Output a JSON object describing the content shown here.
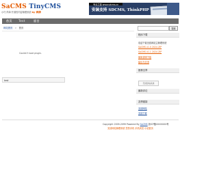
{
  "logo": {
    "part1": "SaCMS",
    "part2": "TinyCMS",
    "tagline": "小巧·简单·开源的内容管理系统",
    "accent": "by 奔牌"
  },
  "banner": {
    "url": "专业之选 www.sdcms.cn",
    "text": "安装支持 SDCMS, ThinkPHP",
    "bg_color": "#2a3f66"
  },
  "nav": {
    "items": [
      "首页",
      "Test",
      "留言"
    ]
  },
  "breadcrumb": {
    "home": "网站首页",
    "separator": ">",
    "current": "首页"
  },
  "search": {
    "placeholder": "",
    "button": "搜索"
  },
  "main": {
    "message": "Couldn't load plugin.",
    "textbox": "test"
  },
  "sidebar": {
    "download_title": "程序下载",
    "download_desc": "欢迎下载无线网站主管理系统",
    "download_links": [
      "SaCMS v1.0 2024 ZIP",
      "SaCMS v1.1 2024 ZIP",
      "使用说明下载",
      "建议与交流"
    ],
    "recommend_title": "推荐文章",
    "recommend_image_alt": "无线建站系统",
    "latest_comments_title": "最新评论",
    "friendlinks_title": "友情链接",
    "friendlinks": [
      "无线网站",
      "无线下载"
    ]
  },
  "footer": {
    "copyright_prefix": "Copyright 2009-2099 Powered By",
    "powered_link": "SaCMS",
    "icp": "浙ICP备XXXXXXX号",
    "sub": "无线网站管理系统 您的手机 手机浏览 小站首页"
  },
  "colors": {
    "accent": "#e45b00",
    "link": "#1e4f9c",
    "nav_bg": "#6b6b6b"
  }
}
